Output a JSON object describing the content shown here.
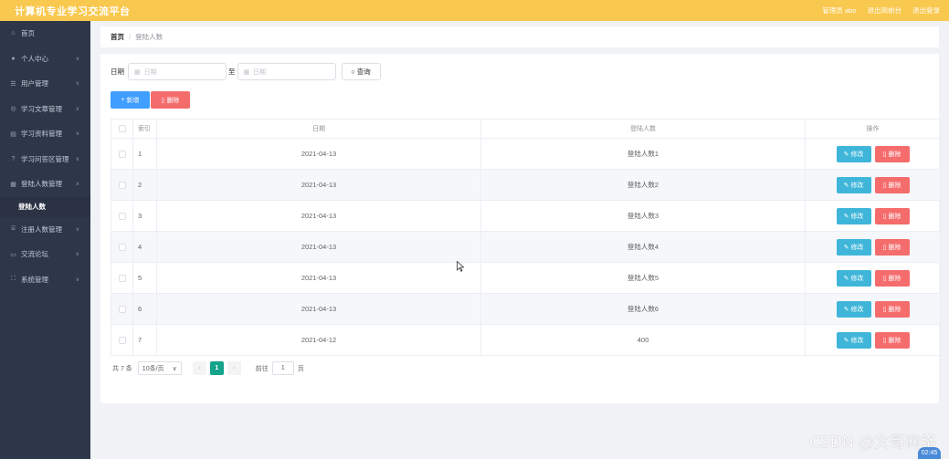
{
  "header": {
    "app_title": "计算机专业学习交流平台",
    "user_label": "管理员 abo",
    "front_link": "退出到前台",
    "logout_link": "退出登录"
  },
  "sidebar": {
    "items": [
      {
        "label": "首页",
        "icon": "home-icon",
        "has_chevron": false
      },
      {
        "label": "个人中心",
        "icon": "user-icon",
        "has_chevron": true
      },
      {
        "label": "用户管理",
        "icon": "grid-icon",
        "has_chevron": true
      },
      {
        "label": "学习文章管理",
        "icon": "globe-icon",
        "has_chevron": true
      },
      {
        "label": "学习资料管理",
        "icon": "book-icon",
        "has_chevron": true
      },
      {
        "label": "学习问答区管理",
        "icon": "question-icon",
        "has_chevron": true
      },
      {
        "label": "登陆人数管理",
        "icon": "list-icon",
        "has_chevron": true,
        "expanded": true
      },
      {
        "label": "注册人数管理",
        "icon": "bank-icon",
        "has_chevron": true
      },
      {
        "label": "交流论坛",
        "icon": "chat-icon",
        "has_chevron": true
      },
      {
        "label": "系统管理",
        "icon": "expand-icon",
        "has_chevron": true
      }
    ],
    "submenu_active": "登陆人数"
  },
  "breadcrumb": {
    "home": "首页",
    "sep": "/",
    "current": "登陆人数"
  },
  "search": {
    "date_label": "日期",
    "start_placeholder": "日期",
    "to_label": "至",
    "end_placeholder": "日期",
    "query_button": "查询"
  },
  "actions": {
    "add_button": "新增",
    "delete_button": "删除"
  },
  "table": {
    "columns": [
      "索引",
      "日期",
      "登陆人数",
      "操作"
    ],
    "edit_label": "修改",
    "delete_label": "删除",
    "rows": [
      {
        "index": "1",
        "date": "2021-04-13",
        "count": "登陆人数1"
      },
      {
        "index": "2",
        "date": "2021-04-13",
        "count": "登陆人数2"
      },
      {
        "index": "3",
        "date": "2021-04-13",
        "count": "登陆人数3"
      },
      {
        "index": "4",
        "date": "2021-04-13",
        "count": "登陆人数4"
      },
      {
        "index": "5",
        "date": "2021-04-13",
        "count": "登陆人数5"
      },
      {
        "index": "6",
        "date": "2021-04-13",
        "count": "登陆人数6"
      },
      {
        "index": "7",
        "date": "2021-04-12",
        "count": "400"
      }
    ]
  },
  "pagination": {
    "total": "共 7 条",
    "page_size": "10条/页",
    "current_page": "1",
    "goto_label": "前往",
    "goto_value": "1",
    "page_suffix": "页"
  },
  "overlay": {
    "watermark": "CSDN @文哥网络",
    "clock": "02:45"
  },
  "colors": {
    "topbar": "#f9c84e",
    "sidebar": "#2e3748",
    "primary": "#409eff",
    "danger": "#f56c6c",
    "edit": "#3fb6d9",
    "page_active": "#14a38b"
  }
}
